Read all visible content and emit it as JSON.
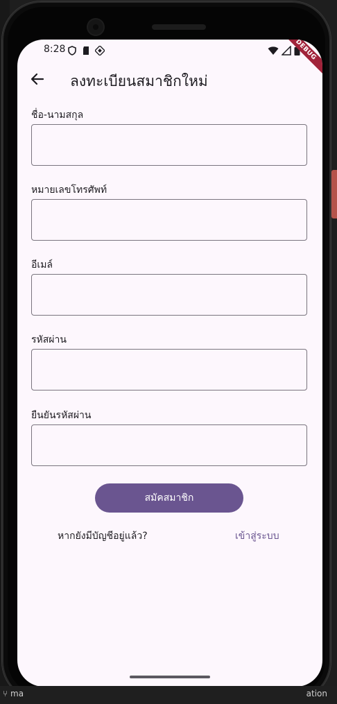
{
  "status_bar": {
    "time": "8:28",
    "debug_label": "DEBUG"
  },
  "app_bar": {
    "title": "ลงทะเบียนสมาชิกใหม่"
  },
  "form": {
    "fields": [
      {
        "label": "ชื่อ-นามสกุล",
        "value": "",
        "placeholder": ""
      },
      {
        "label": "หมายเลขโทรศัพท์",
        "value": "",
        "placeholder": ""
      },
      {
        "label": "อีเมล์",
        "value": "",
        "placeholder": ""
      },
      {
        "label": "รหัสผ่าน",
        "value": "",
        "placeholder": ""
      },
      {
        "label": "ยืนยันรหัสผ่าน",
        "value": "",
        "placeholder": ""
      }
    ],
    "submit_label": "สมัคสมาชิก",
    "login_prompt": "หากยังมีบัญชีอยู่แล้ว?",
    "login_link": "เข้าสู่ระบบ"
  },
  "colors": {
    "background": "#fdf7fd",
    "primary": "#6a5590",
    "text": "#1d1b20",
    "outline": "#79747e",
    "debug": "#a1233a"
  },
  "icons": {
    "back": "arrow-left-icon",
    "status_left": [
      "shield-icon",
      "sd-card-icon",
      "app-icon"
    ],
    "status_right": [
      "wifi-icon",
      "signal-icon",
      "battery-icon"
    ]
  },
  "ide": {
    "branch": "ma",
    "right_text": "ation"
  }
}
